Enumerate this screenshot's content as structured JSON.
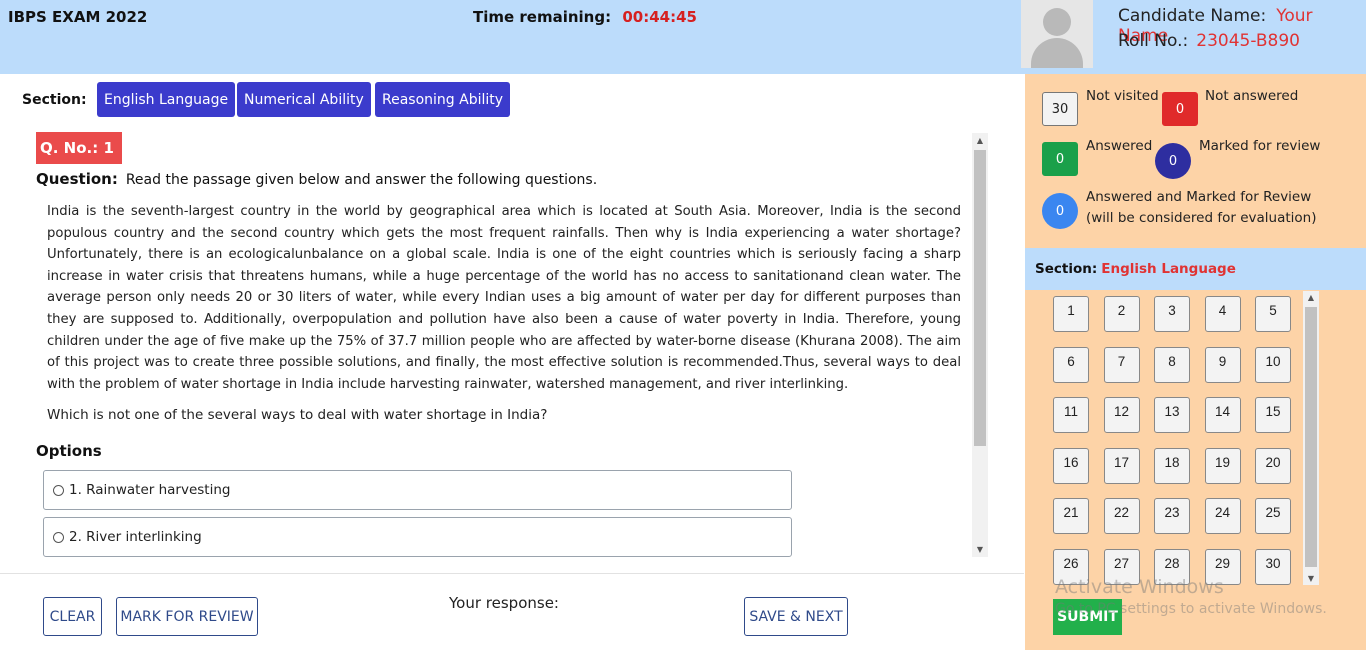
{
  "header": {
    "exam_title": "IBPS EXAM 2022",
    "timer_label": "Time remaining:",
    "timer_value": "00:44:45"
  },
  "candidate": {
    "name_label": "Candidate Name:",
    "name_value": "Your Name",
    "roll_label": "Roll No.:",
    "roll_value": "23045-B890"
  },
  "sections": {
    "label": "Section:",
    "tabs": [
      "English Language",
      "Numerical Ability",
      "Reasoning Ability"
    ]
  },
  "question": {
    "number_label": "Q. No.: 1",
    "question_label": "Question:",
    "question_text": "Read the passage given below and answer the following questions.",
    "passage": "India is the seventh-largest country in the world by geographical area which is located at South Asia. Moreover, India is the second populous country and the second country which gets the most frequent rainfalls. Then why is India experiencing a water shortage? Unfortunately, there is an ecologicalunbalance on a global scale. India is one of the eight countries which is seriously facing a sharp increase in water crisis that threatens humans, while a huge percentage of the world has no access to sanitationand clean water. The average person only needs 20 or 30 liters of water, while every Indian uses a big amount of water per day for different purposes than they are supposed to. Additionally, overpopulation and pollution have also been a cause of water poverty in India. Therefore, young children under the age of five make up the 75% of 37.7 million people who are affected by water-borne disease (Khurana 2008). The aim of this project was to create three possible solutions, and finally, the most effective solution is recommended.Thus, several ways to deal with the problem of water shortage in India include harvesting rainwater, watershed management, and river interlinking.",
    "prompt": "Which is not one of the several ways to deal with water shortage in India?",
    "options_heading": "Options",
    "options": [
      "1. Rainwater harvesting",
      "2. River interlinking"
    ]
  },
  "bottom": {
    "clear_label": "CLEAR",
    "mark_label": "MARK FOR REVIEW",
    "response_label": "Your response:",
    "save_label": "SAVE & NEXT"
  },
  "legend": {
    "not_visited_count": "30",
    "not_visited_label": "Not visited",
    "not_answered_count": "0",
    "not_answered_label": "Not answered",
    "answered_count": "0",
    "answered_label": "Answered",
    "marked_count": "0",
    "marked_label": "Marked for review",
    "ans_marked_count": "0",
    "ans_marked_label_1": "Answered and Marked for Review",
    "ans_marked_label_2": "(will be considered for evaluation)",
    "colors": {
      "not_answered": "#e02a2a",
      "answered": "#1aa04a",
      "marked": "#2e2ea0",
      "ans_marked": "#3a86f0"
    }
  },
  "palette": {
    "section_label": "Section:",
    "section_value": "English Language",
    "numbers": [
      "1",
      "2",
      "3",
      "4",
      "5",
      "6",
      "7",
      "8",
      "9",
      "10",
      "11",
      "12",
      "13",
      "14",
      "15",
      "16",
      "17",
      "18",
      "19",
      "20",
      "21",
      "22",
      "23",
      "24",
      "25",
      "26",
      "27",
      "28",
      "29",
      "30"
    ]
  },
  "watermark": {
    "line1": "Activate Windows",
    "line2": "Go to PC settings to activate Windows."
  },
  "submit_label": "SUBMIT"
}
